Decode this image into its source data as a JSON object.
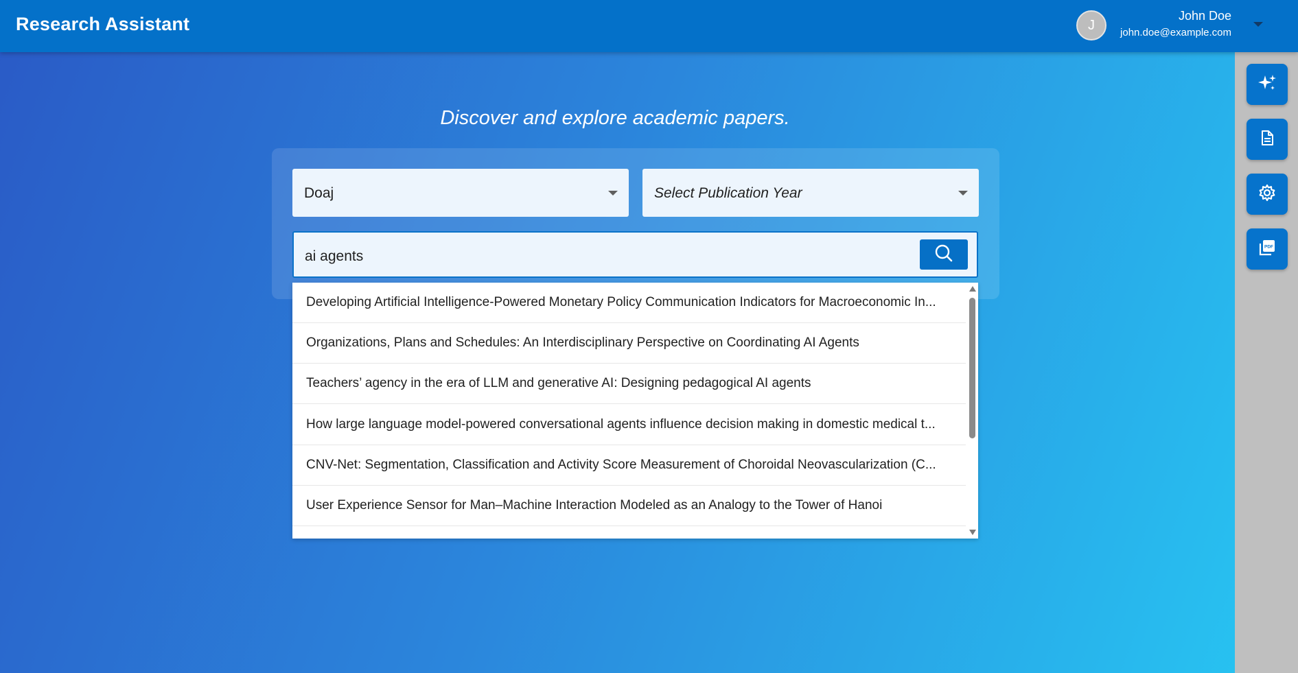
{
  "header": {
    "title": "Research Assistant",
    "user": {
      "avatar_initial": "J",
      "name": "John Doe",
      "email": "john.doe@example.com"
    }
  },
  "right_rail": {
    "buttons": [
      {
        "name": "ai-sparkle",
        "icon": "sparkle-icon"
      },
      {
        "name": "document",
        "icon": "document-icon"
      },
      {
        "name": "settings",
        "icon": "gear-icon"
      },
      {
        "name": "pdf-library",
        "icon": "pdf-icon"
      }
    ]
  },
  "main": {
    "tagline": "Discover and explore academic papers.",
    "source_select": {
      "value": "Doaj"
    },
    "year_select": {
      "placeholder": "Select Publication Year"
    },
    "search": {
      "value": "ai agents"
    },
    "results": [
      "Developing Artificial Intelligence-Powered Monetary Policy Communication Indicators for Macroeconomic In...",
      "Organizations, Plans and Schedules: An Interdisciplinary Perspective on Coordinating AI Agents",
      "Teachers’ agency in the era of LLM and generative AI: Designing pedagogical AI agents",
      "How large language model-powered conversational agents influence decision making in domestic medical t...",
      "CNV-Net: Segmentation, Classification and Activity Score Measurement of Choroidal Neovascularization (C...",
      "User Experience Sensor for Man–Machine Interaction Modeled as an Analogy to the Tower of Hanoi"
    ]
  },
  "colors": {
    "header_bg": "#0471c9",
    "accent": "#0670c6",
    "gradient_start": "#2a5ac6",
    "gradient_end": "#27c6f2",
    "rail_bg": "#bfbfbf"
  }
}
